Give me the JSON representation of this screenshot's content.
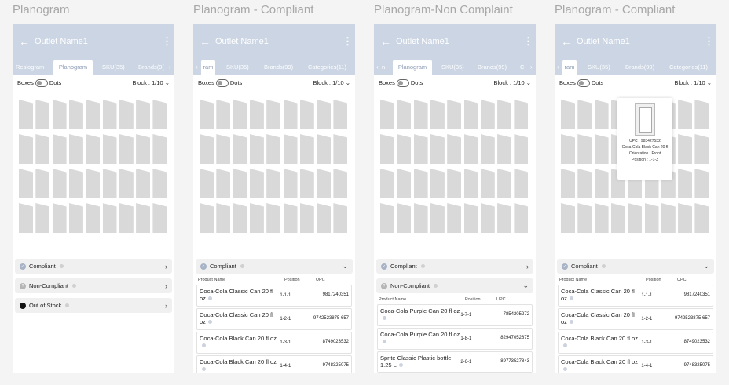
{
  "screens": [
    {
      "title": "Planogram",
      "appbar": {
        "title": "Outlet Name1"
      },
      "tabs": [
        {
          "label": "Reslogram",
          "active": false
        },
        {
          "label": "Planogram",
          "active": true
        },
        {
          "label": "SKU(35)",
          "active": false
        },
        {
          "label": "Brands(9(",
          "active": false
        }
      ],
      "tab_arrows": {
        "left": "",
        "right": "›"
      },
      "controls": {
        "boxes": "Boxes",
        "dots": "Dots",
        "block": "Block : 1/10"
      },
      "sections": [
        {
          "label": "Compliant",
          "chevron": "›",
          "expanded": false
        },
        {
          "label": "Non-Compliant",
          "chevron": "›",
          "expanded": false
        },
        {
          "label": "Out of Stock",
          "chevron": "›",
          "expanded": false
        }
      ]
    },
    {
      "title": "Planogram - Compliant",
      "appbar": {
        "title": "Outlet Name1"
      },
      "tabs": [
        {
          "label": "ram",
          "active": true
        },
        {
          "label": "SKU(35)",
          "active": false
        },
        {
          "label": "Brands(99)",
          "active": false
        },
        {
          "label": "Categories(11)",
          "active": false
        }
      ],
      "tab_arrows": {
        "left": "‹",
        "right": ""
      },
      "controls": {
        "boxes": "Boxes",
        "dots": "Dots",
        "block": "Block : 1/10"
      },
      "sections": [
        {
          "label": "Compliant",
          "chevron": "⌄",
          "expanded": true,
          "headers": {
            "name": "Product Name",
            "position": "Position",
            "upc": "UPC"
          },
          "rows": [
            {
              "name": "Coca-Cola Classic Can 20 fl oz",
              "position": "1-1-1",
              "upc": "9817240351"
            },
            {
              "name": "Coca-Cola Classic Can 20 fl oz",
              "position": "1-2-1",
              "upc": "9742523875 657"
            },
            {
              "name": "Coca-Cola Black Can 20 fl oz",
              "position": "1-3-1",
              "upc": "8749023532"
            },
            {
              "name": "Coca-Cola Black Can 20 fl oz",
              "position": "1-4-1",
              "upc": "9748325075"
            }
          ]
        }
      ]
    },
    {
      "title": "Planogram-Non Complaint",
      "appbar": {
        "title": "Outlet Name1"
      },
      "tabs": [
        {
          "label": "n",
          "active": false
        },
        {
          "label": "Planogram",
          "active": true
        },
        {
          "label": "SKU(35)",
          "active": false
        },
        {
          "label": "Brands(99)",
          "active": false
        },
        {
          "label": "C",
          "active": false
        }
      ],
      "tab_arrows": {
        "left": "‹",
        "right": "›"
      },
      "controls": {
        "boxes": "Boxes",
        "dots": "Dots",
        "block": "Block : 1/10"
      },
      "sections": [
        {
          "label": "Compliant",
          "chevron": "›",
          "expanded": false
        },
        {
          "label": "Non-Compliant",
          "chevron": "⌄",
          "expanded": true,
          "headers": {
            "name": "Product Name",
            "position": "Position",
            "upc": "UPC"
          },
          "rows": [
            {
              "name": "Coca-Cola Purple Can 20 fl oz",
              "position": "1-7-1",
              "upc": "7854205272"
            },
            {
              "name": "Coca-Cola Purple Can 20 fl oz",
              "position": "1-8-1",
              "upc": "82947052875"
            },
            {
              "name": "Sprite Classic Plastic bottle 1.25 L",
              "position": "2-6-1",
              "upc": "89773527843"
            }
          ]
        }
      ]
    },
    {
      "title": "Planogram - Compliant",
      "appbar": {
        "title": "Outlet Name1"
      },
      "tabs": [
        {
          "label": "ram",
          "active": true
        },
        {
          "label": "SKU(35)",
          "active": false
        },
        {
          "label": "Brands(99)",
          "active": false
        },
        {
          "label": "Categories(11)",
          "active": false
        }
      ],
      "tab_arrows": {
        "left": "‹",
        "right": ""
      },
      "controls": {
        "boxes": "Boxes",
        "dots": "Dots",
        "block": "Block : 1/10"
      },
      "popup": {
        "upc": "UPC : 983427532",
        "name": "Coca-Cola Black Can 20 fl",
        "orientation": "Orientation : Front",
        "position": "Position : 1-1-3"
      },
      "sections": [
        {
          "label": "Compliant",
          "chevron": "⌄",
          "expanded": true,
          "headers": {
            "name": "Product Name",
            "position": "Position",
            "upc": "UPC"
          },
          "rows": [
            {
              "name": "Coca-Cola Classic Can 20 fl oz",
              "position": "1-1-1",
              "upc": "9817240351"
            },
            {
              "name": "Coca-Cola Classic Can 20 fl oz",
              "position": "1-2-1",
              "upc": "9742523875 657"
            },
            {
              "name": "Coca-Cola Black Can 20 fl oz",
              "position": "1-3-1",
              "upc": "8749023532"
            },
            {
              "name": "Coca-Cola Black Can 20 fl oz",
              "position": "1-4-1",
              "upc": "9748325075"
            }
          ]
        }
      ]
    }
  ],
  "colors": {
    "appbar": "#cbd5e3",
    "cell": "#d9d9d9",
    "title": "#a8a8a8"
  },
  "icons": {
    "back": "arrow-left-icon",
    "menu": "kebab-menu-icon",
    "compliant": "check-circle-icon",
    "non_compliant": "question-circle-icon",
    "out_of_stock": "filled-circle-icon",
    "info": "info-icon",
    "expand": "chevron-icon"
  }
}
